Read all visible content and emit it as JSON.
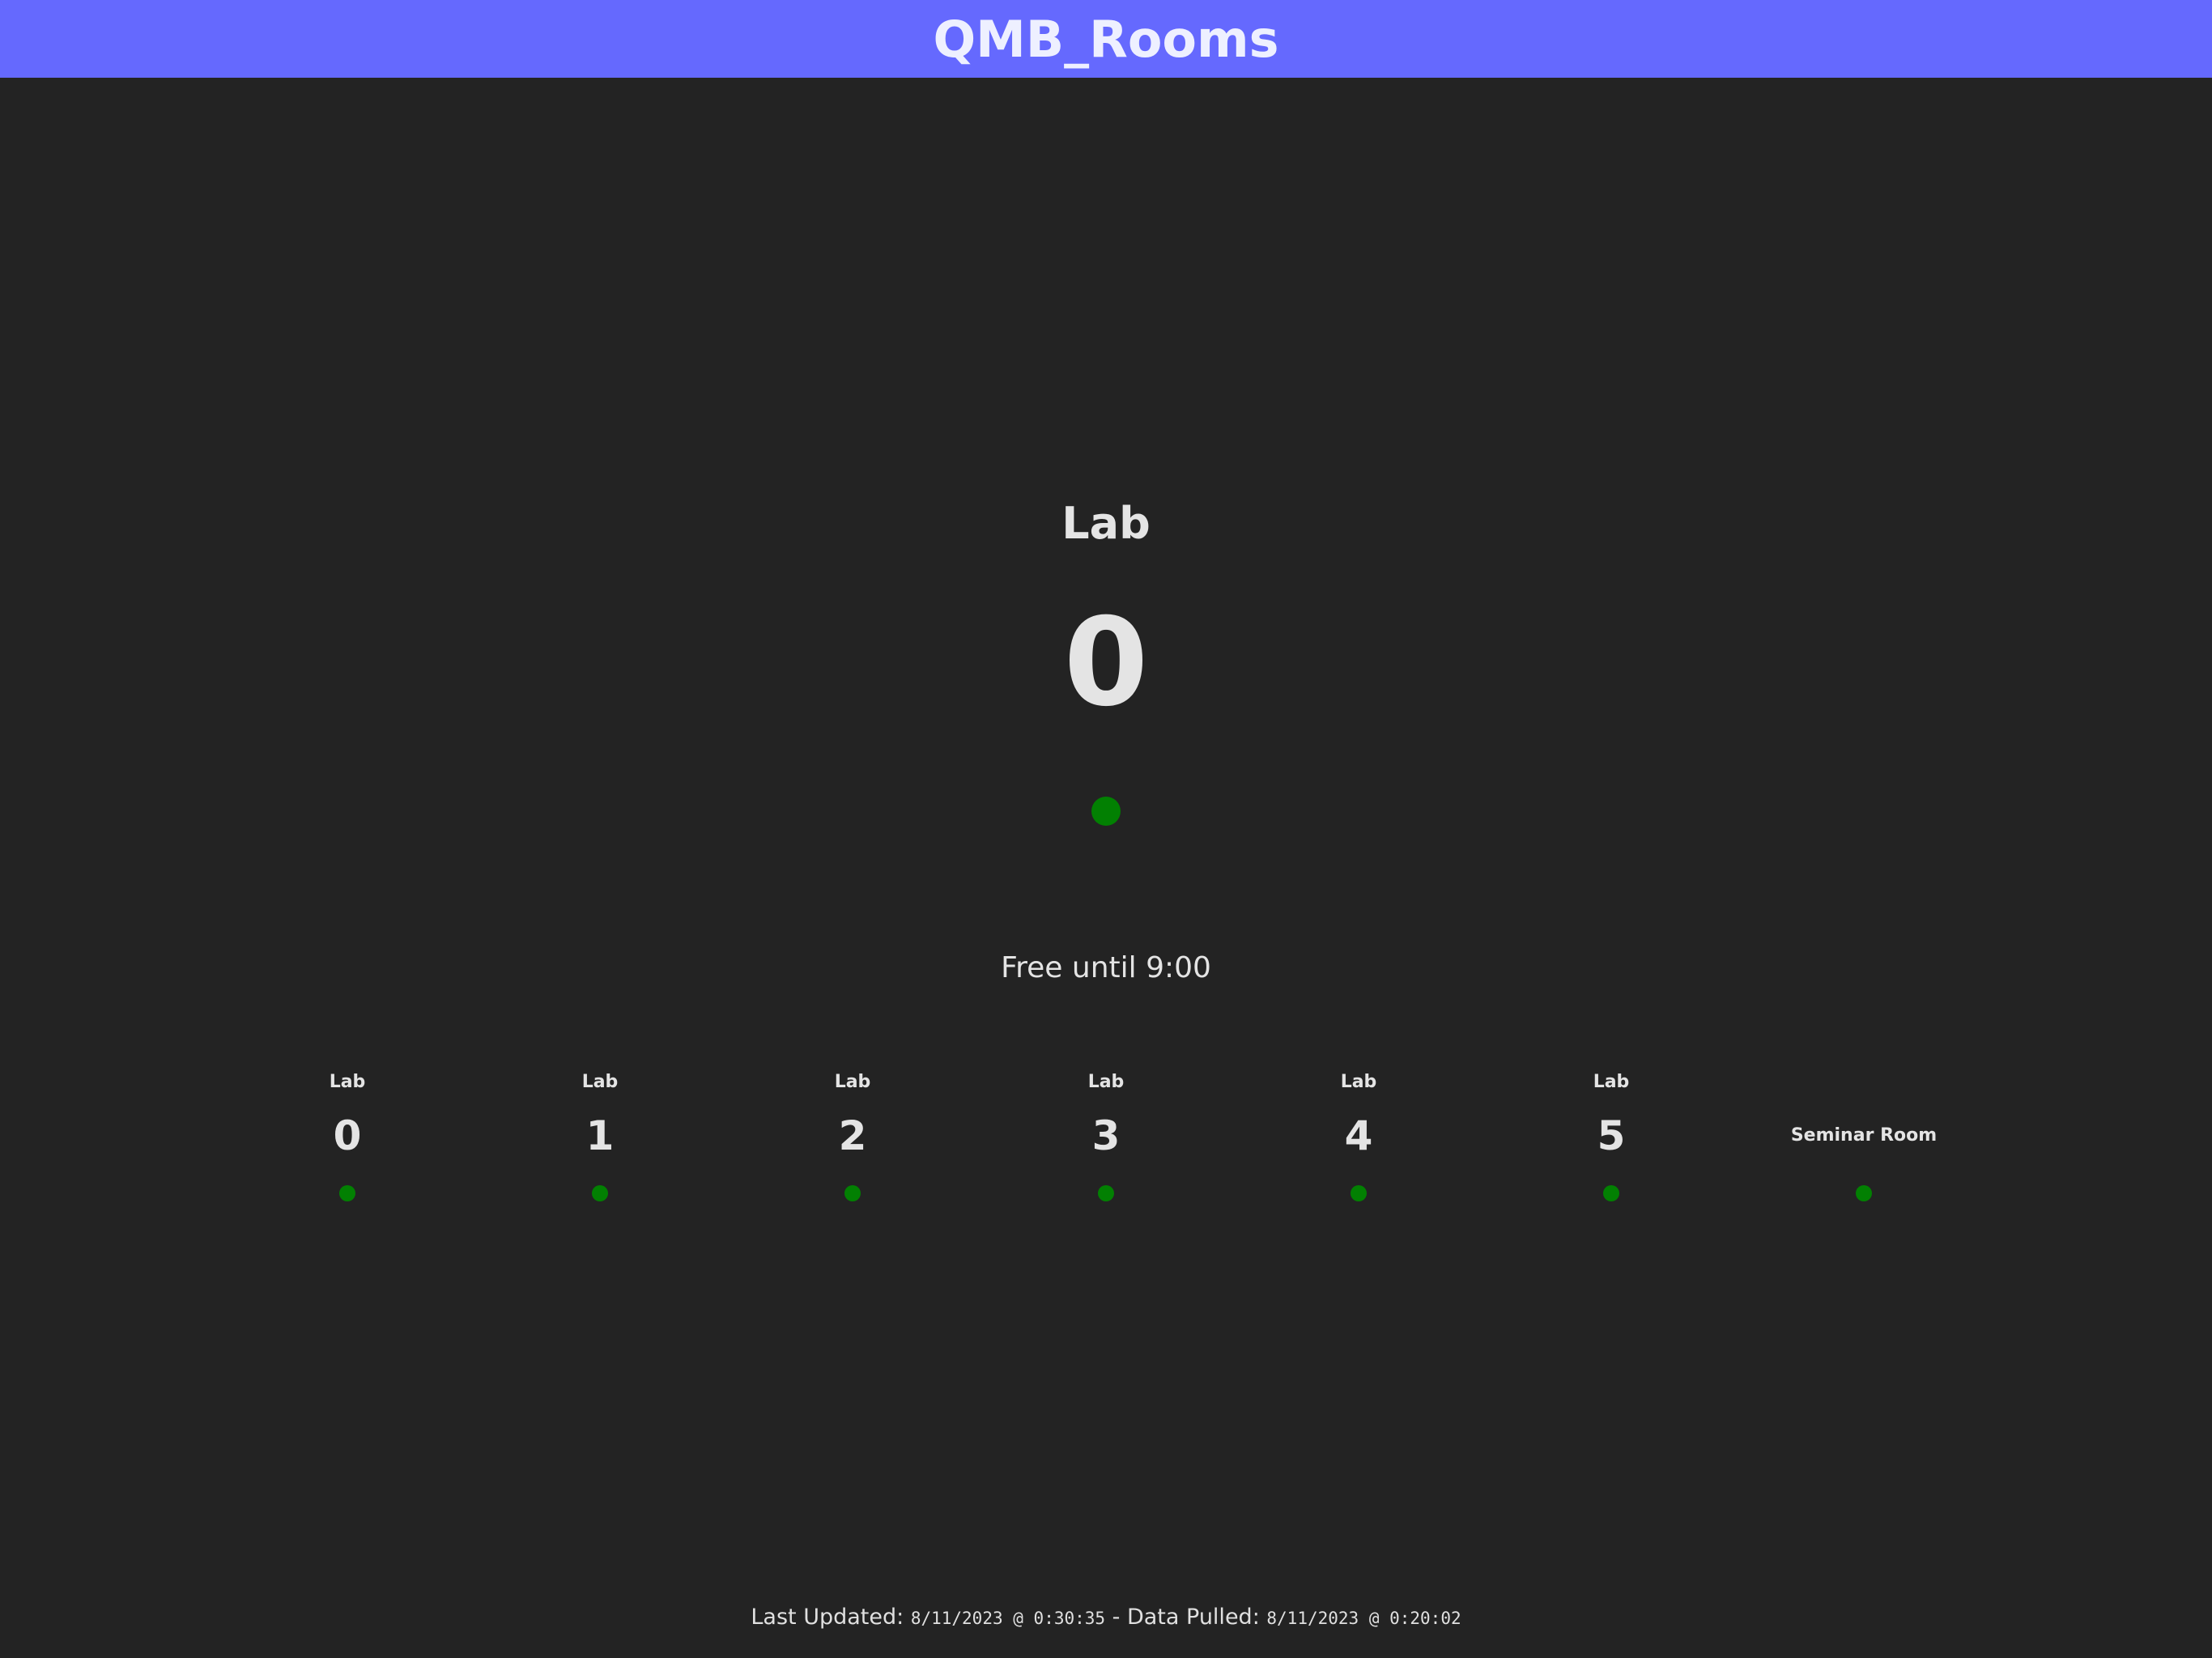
{
  "header": {
    "title": "QMB_Rooms",
    "color": "#6569fe"
  },
  "main_room": {
    "label": "Lab",
    "number": "0",
    "status_color": "#028002",
    "status_text": "Free until 9:00"
  },
  "rooms": [
    {
      "label": "Lab",
      "number": "0",
      "status_color": "#028002"
    },
    {
      "label": "Lab",
      "number": "1",
      "status_color": "#028002"
    },
    {
      "label": "Lab",
      "number": "2",
      "status_color": "#028002"
    },
    {
      "label": "Lab",
      "number": "3",
      "status_color": "#028002"
    },
    {
      "label": "Lab",
      "number": "4",
      "status_color": "#028002"
    },
    {
      "label": "Lab",
      "number": "5",
      "status_color": "#028002"
    },
    {
      "label": "Seminar Room",
      "number": "",
      "status_color": "#028002"
    }
  ],
  "footer": {
    "last_updated_label": "Last Updated:",
    "last_updated_value": "8/11/2023 @ 0:30:35",
    "separator": "- Data Pulled:",
    "data_pulled_value": "8/11/2023 @ 0:20:02"
  }
}
